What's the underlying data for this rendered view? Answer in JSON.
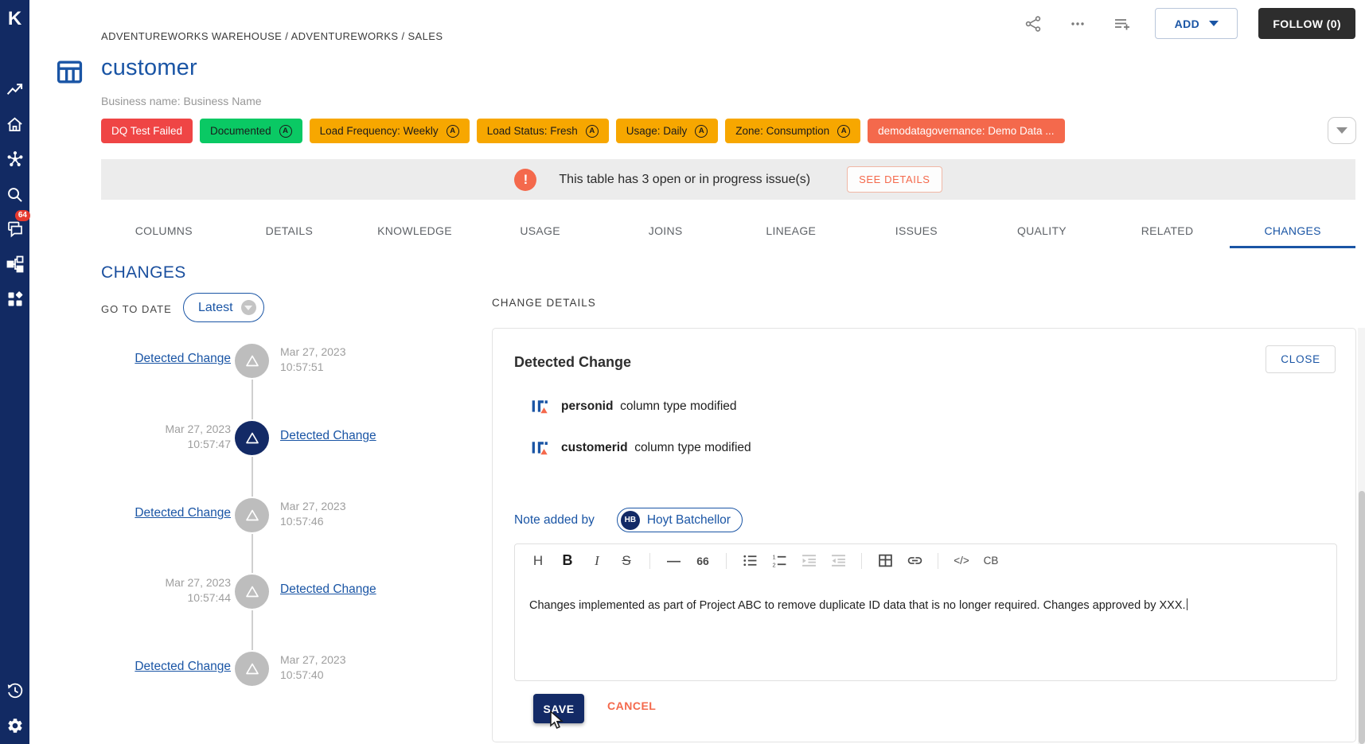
{
  "app": {
    "logo_letter": "K"
  },
  "sidebar": {
    "icons": [
      "metrics",
      "home",
      "network",
      "search",
      "comments",
      "hierarchy",
      "apps",
      "history",
      "settings"
    ],
    "chat_badge": "64"
  },
  "header": {
    "breadcrumb": "ADVENTUREWORKS WAREHOUSE / ADVENTUREWORKS / SALES",
    "title": "customer",
    "subtitle": "Business name: Business Name",
    "actions": {
      "add_label": "ADD",
      "follow_label": "FOLLOW (0)"
    }
  },
  "tags": {
    "auto_icon_letter": "A",
    "items": [
      {
        "label": "DQ Test Failed",
        "color": "#ef4545",
        "text_color": "#ffffff",
        "auto_badge": false
      },
      {
        "label": "Documented",
        "color": "#0ac964",
        "text_color": "#1b1b1b",
        "auto_badge": true
      },
      {
        "label": "Load Frequency: Weekly",
        "color": "#f7a700",
        "text_color": "#1b1b1b",
        "auto_badge": true
      },
      {
        "label": "Load Status: Fresh",
        "color": "#f7a700",
        "text_color": "#1b1b1b",
        "auto_badge": true
      },
      {
        "label": "Usage: Daily",
        "color": "#f7a700",
        "text_color": "#1b1b1b",
        "auto_badge": true
      },
      {
        "label": "Zone: Consumption",
        "color": "#f7a700",
        "text_color": "#1b1b1b",
        "auto_badge": true
      },
      {
        "label": "demodatagovernance: Demo Data ...",
        "color": "#f4694c",
        "text_color": "#ffffff",
        "auto_badge": false
      }
    ]
  },
  "banner": {
    "text": "This table has 3 open or in progress issue(s)",
    "button_label": "SEE DETAILS"
  },
  "tabs": {
    "items": [
      "COLUMNS",
      "DETAILS",
      "KNOWLEDGE",
      "USAGE",
      "JOINS",
      "LINEAGE",
      "ISSUES",
      "QUALITY",
      "RELATED",
      "CHANGES"
    ],
    "active": "CHANGES"
  },
  "changes_panel": {
    "heading": "CHANGES",
    "go_to_date_label": "GO TO DATE",
    "date_selector_value": "Latest",
    "entries": [
      {
        "label": "Detected Change",
        "date": "Mar 27, 2023",
        "time": "10:57:51",
        "link_side": "left",
        "selected": false
      },
      {
        "label": "Detected Change",
        "date": "Mar 27, 2023",
        "time": "10:57:47",
        "link_side": "right",
        "selected": true
      },
      {
        "label": "Detected Change",
        "date": "Mar 27, 2023",
        "time": "10:57:46",
        "link_side": "left",
        "selected": false
      },
      {
        "label": "Detected Change",
        "date": "Mar 27, 2023",
        "time": "10:57:44",
        "link_side": "right",
        "selected": false
      },
      {
        "label": "Detected Change",
        "date": "Mar 27, 2023",
        "time": "10:57:40",
        "link_side": "left",
        "selected": false
      }
    ]
  },
  "details_panel": {
    "heading": "CHANGE DETAILS",
    "card_title": "Detected Change",
    "close_label": "CLOSE",
    "changes": [
      {
        "name": "personid",
        "description": "column type modified"
      },
      {
        "name": "customerid",
        "description": "column type modified"
      }
    ],
    "note": {
      "label": "Note added by",
      "avatar_initials": "HB",
      "author": "Hoyt Batchellor"
    },
    "editor": {
      "toolbar": {
        "heading": "H",
        "bold": "B",
        "italic": "I",
        "strike": "S",
        "hr": "—",
        "quote": "66",
        "code": "</>",
        "codeblock": "CB"
      },
      "content": "Changes implemented as part of Project ABC to remove duplicate ID data that is no longer required. Changes approved by XXX.",
      "save_label": "SAVE",
      "cancel_label": "CANCEL"
    }
  },
  "colors": {
    "sidebar": "#122a63",
    "accent_blue": "#1a55a5",
    "tag_red": "#ef4545",
    "tag_green": "#0ac964",
    "tag_amber": "#f7a700",
    "tag_coral": "#f4694c",
    "banner_bg": "#ececec",
    "follow_button": "#2d2d2d",
    "save_button": "#132a66",
    "badge_red": "#e5392e"
  }
}
